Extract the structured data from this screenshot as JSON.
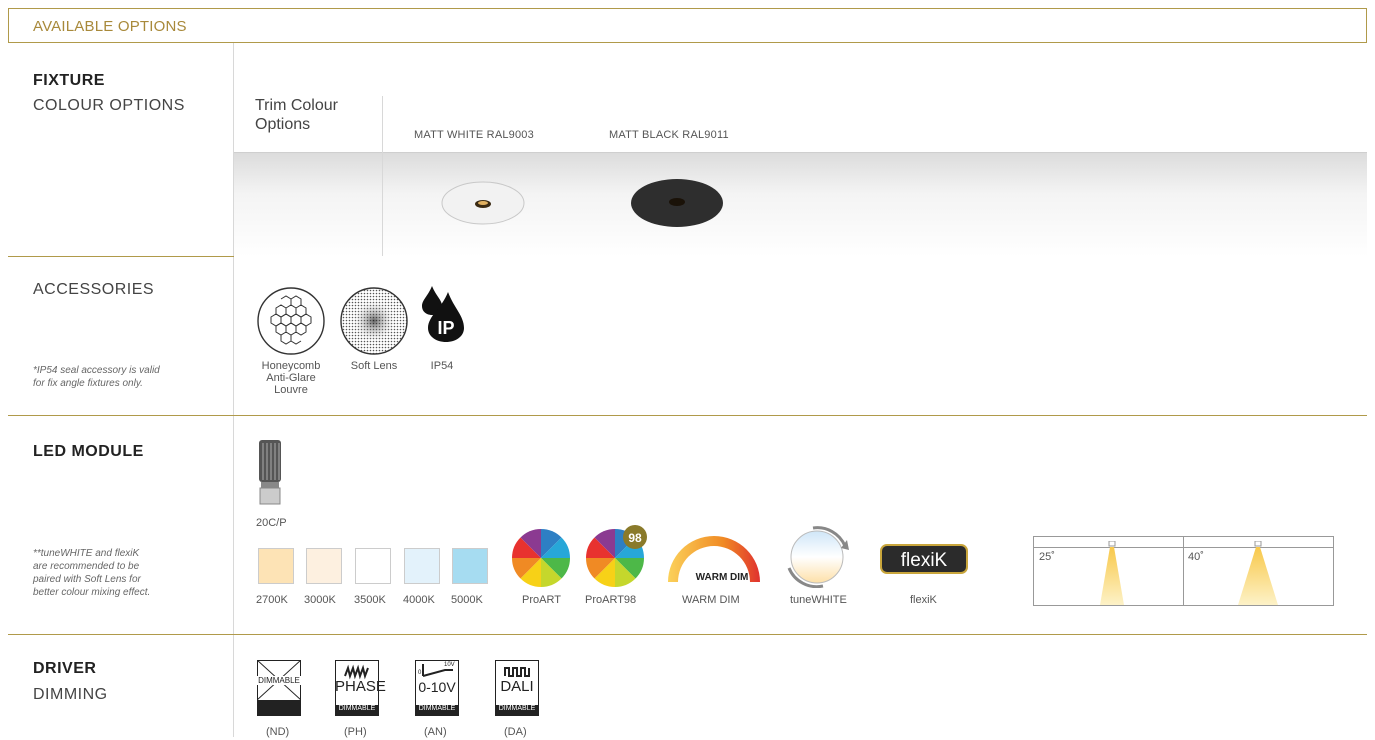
{
  "header": {
    "title": "AVAILABLE OPTIONS"
  },
  "fixture": {
    "heading": "FIXTURE",
    "subheading": "COLOUR OPTIONS",
    "trim_label_1": "Trim Colour",
    "trim_label_2": "Options",
    "colours": [
      "MATT WHITE RAL9003",
      "MATT BLACK RAL9011"
    ]
  },
  "accessories": {
    "heading": "ACCESSORIES",
    "note_1": "*IP54 seal accessory is valid",
    "note_2": "for fix angle fixtures only.",
    "items": [
      {
        "line1": "Honeycomb",
        "line2": "Anti-Glare",
        "line3": "Louvre"
      },
      {
        "line1": "Soft Lens"
      },
      {
        "line1": "IP54"
      }
    ],
    "ip_icon_text": "IP"
  },
  "led": {
    "heading": "LED MODULE",
    "module_name": "20C/P",
    "note_1": "**tuneWHITE and flexiK",
    "note_2": "are recommended to be",
    "note_3": "paired with Soft Lens for",
    "note_4": "better colour mixing effect.",
    "temps": [
      {
        "label": "2700K",
        "color": "#fde3b5"
      },
      {
        "label": "3000K",
        "color": "#fdf0e0"
      },
      {
        "label": "3500K",
        "color": "#ffffff"
      },
      {
        "label": "4000K",
        "color": "#e3f2fb"
      },
      {
        "label": "5000K",
        "color": "#a6dcf1"
      }
    ],
    "options": [
      "ProART",
      "ProART98",
      "WARM DIM",
      "tuneWHITE",
      "flexiK"
    ],
    "proart98_badge": "98",
    "warmdim_icon_text": "WARM DIM",
    "flexik_logo": "flexiK",
    "beams": [
      "25˚",
      "40˚"
    ]
  },
  "driver": {
    "heading": "DRIVER",
    "subheading": "DIMMING",
    "options": [
      {
        "icon_text": "DIMMABLE",
        "code": "(ND)"
      },
      {
        "icon_text": "PHASE",
        "sub": "DIMMABLE",
        "code": "(PH)"
      },
      {
        "icon_text": "0-10V",
        "sub": "DIMMABLE",
        "scale_min": "0",
        "scale_max": "10V",
        "code": "(AN)"
      },
      {
        "icon_text": "DALI",
        "sub": "DIMMABLE",
        "code": "(DA)"
      }
    ]
  }
}
